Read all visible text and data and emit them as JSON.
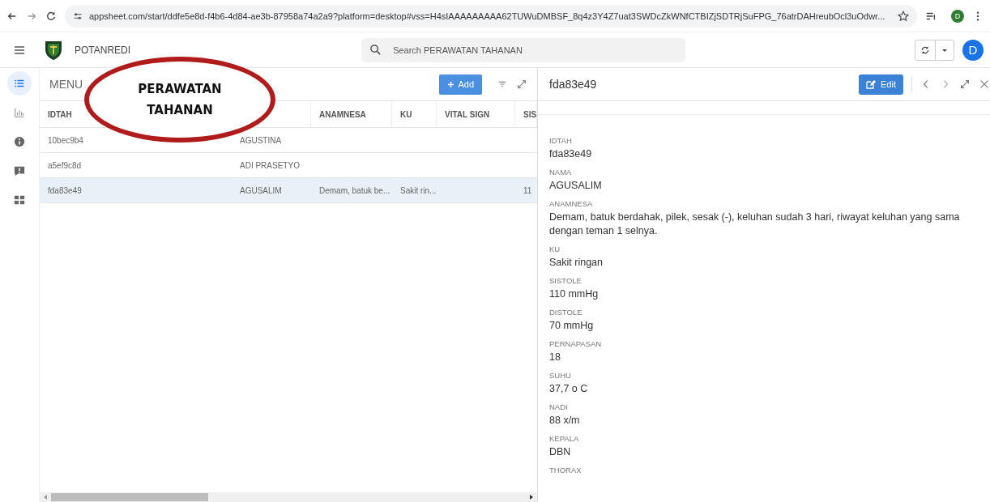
{
  "browser": {
    "url": "appsheet.com/start/ddfe5e8d-f4b6-4d84-ae3b-87958a74a2a9?platform=desktop#vss=H4sIAAAAAAAAA62TUWuDMBSF_8q4z3Y4Z7uat3SWDcZkWNfCTBIZjSDTRjSuFPG_76atrDAHreubOcl3uOdwr...",
    "profile": "D"
  },
  "app": {
    "name": "POTANREDI",
    "search_placeholder": "Search PERAWATAN TAHANAN",
    "avatar": "D"
  },
  "nav": [
    {
      "kind": "list",
      "selected": true
    },
    {
      "kind": "chart",
      "selected": false
    },
    {
      "kind": "info",
      "selected": false
    },
    {
      "kind": "feedback",
      "selected": false
    },
    {
      "kind": "grid",
      "selected": false
    }
  ],
  "list": {
    "title": "MENU",
    "add_label": "Add",
    "columns": [
      "IDTAH",
      "",
      "ANAMNESA",
      "KU",
      "VITAL SIGN",
      "SIS"
    ],
    "rows": [
      {
        "selected": false,
        "cells": [
          "10bec9b4",
          "AGUSTINA",
          "",
          "",
          "",
          ""
        ]
      },
      {
        "selected": false,
        "cells": [
          "a5ef9c8d",
          "ADI PRASETYO",
          "",
          "",
          "",
          ""
        ]
      },
      {
        "selected": true,
        "cells": [
          "fda83e49",
          "AGUSALIM",
          "Demam, batuk be...",
          "Sakit rin...",
          "",
          "11"
        ]
      }
    ]
  },
  "detail": {
    "title": "fda83e49",
    "edit_label": "Edit",
    "fields": [
      {
        "label": "IDTAH",
        "value": "fda83e49"
      },
      {
        "label": "NAMA",
        "value": "AGUSALIM"
      },
      {
        "label": "ANAMNESA",
        "value": "Demam, batuk berdahak, pilek, sesak (-), keluhan sudah 3 hari, riwayat keluhan yang sama dengan teman 1 selnya."
      },
      {
        "label": "KU",
        "value": "Sakit ringan"
      },
      {
        "label": "SISTOLE",
        "value": "110 mmHg"
      },
      {
        "label": "DISTOLE",
        "value": "70 mmHg"
      },
      {
        "label": "PERNAPASAN",
        "value": "18"
      },
      {
        "label": "SUHU",
        "value": "37,7 o C"
      },
      {
        "label": "NADI",
        "value": "88 x/m"
      },
      {
        "label": "KEPALA",
        "value": "DBN"
      },
      {
        "label": "THORAX"
      }
    ]
  },
  "annotation": {
    "text": "PERAWATAN TAHANAN"
  }
}
